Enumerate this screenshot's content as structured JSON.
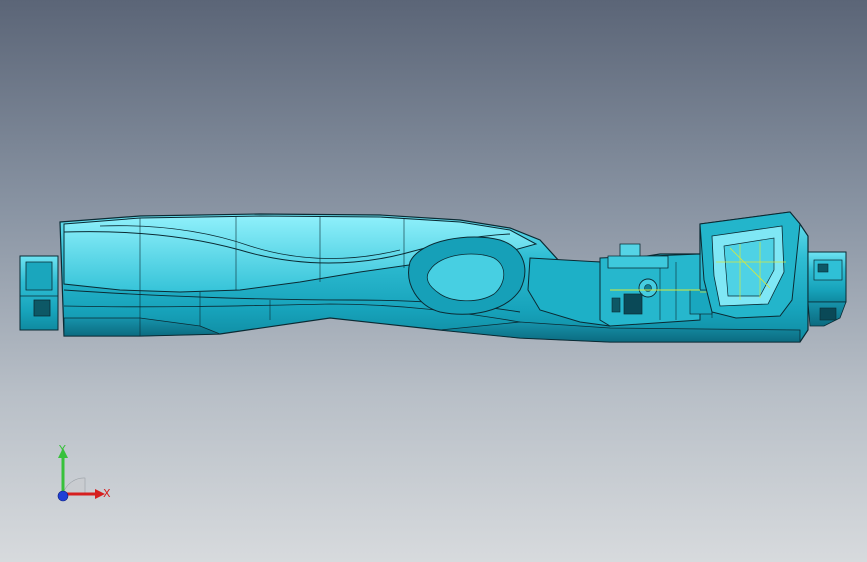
{
  "viewport": {
    "background_top": "#5b6577",
    "background_bottom": "#d7dadd",
    "model_color": "#2fbdd3",
    "edge_color": "#0a2a33",
    "sketch_color": "#d8e83a"
  },
  "triad": {
    "x_label": "X",
    "y_label": "Y",
    "x_color": "#d61f1f",
    "y_color": "#38c13b",
    "z_color": "#1f3fd6"
  }
}
